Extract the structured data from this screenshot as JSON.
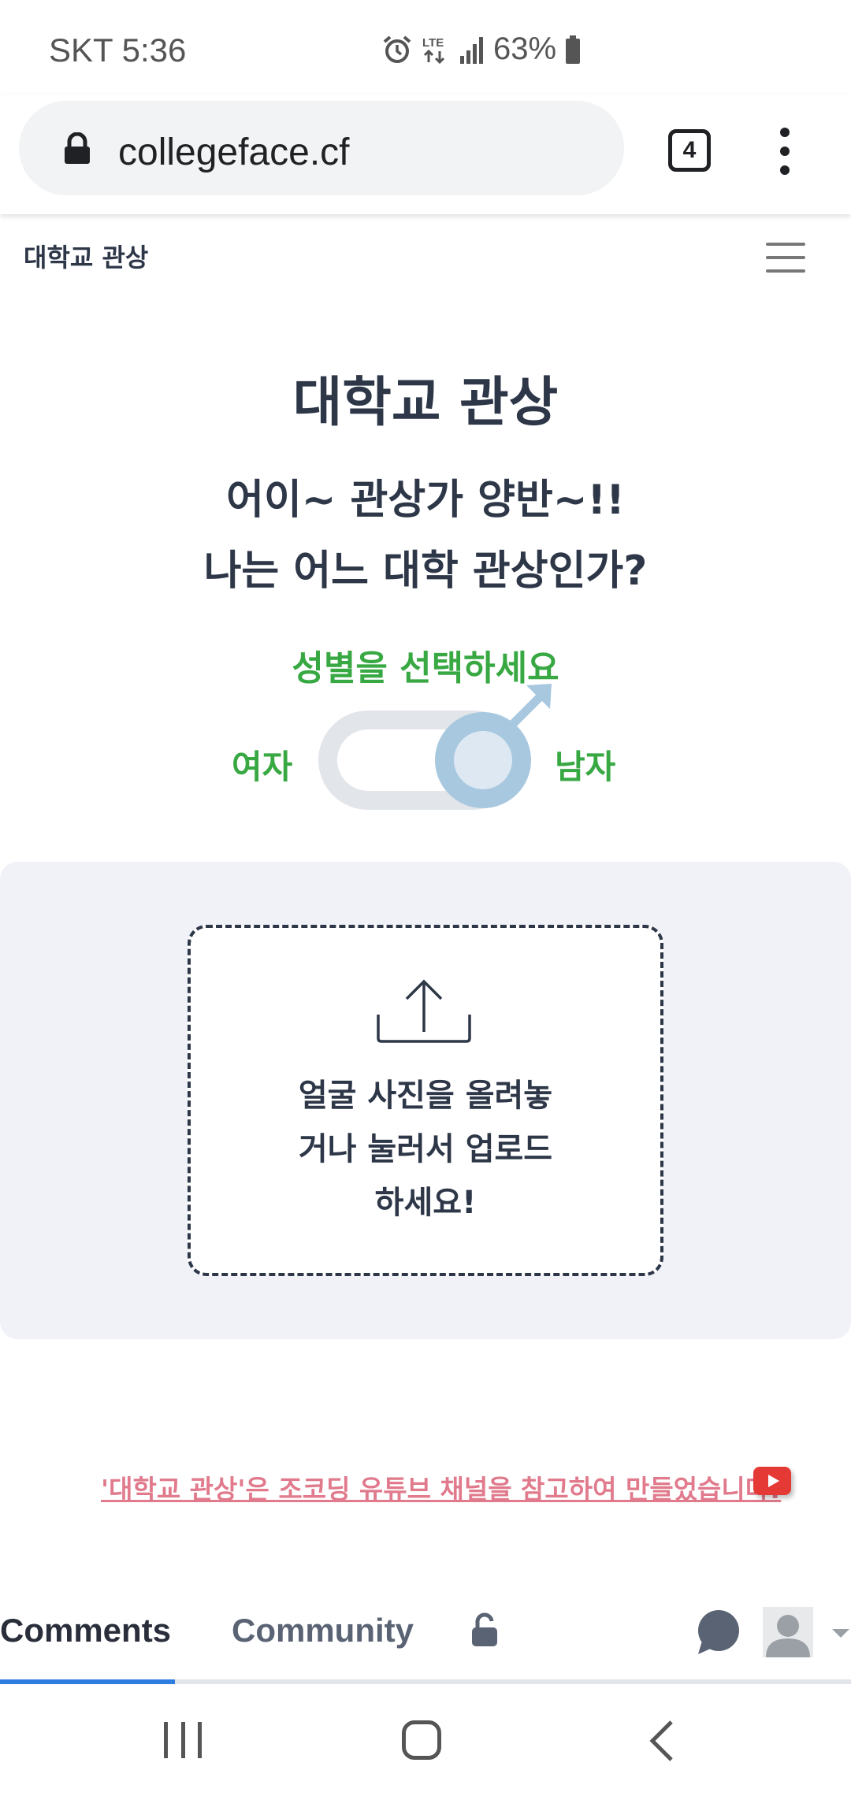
{
  "status_bar": {
    "carrier_time": "SKT 5:36",
    "network": "LTE",
    "battery": "63%",
    "icons": [
      "alarm-icon",
      "lte-icon",
      "signal-icon",
      "battery-icon"
    ]
  },
  "browser": {
    "url": "collegeface.cf",
    "tab_count": "4",
    "icons": [
      "lock-icon",
      "tabs-icon",
      "kebab-menu-icon"
    ]
  },
  "nav": {
    "brand": "대학교 관상",
    "menu_icon": "hamburger-icon"
  },
  "hero": {
    "title": "대학교 관상",
    "line1": "어이~ 관상가 양반~!!",
    "line2": "나는 어느 대학 관상인가?"
  },
  "gender": {
    "prompt": "성별을 선택하세요",
    "female": "여자",
    "male": "남자",
    "selected": "male",
    "icon": "male-symbol-icon"
  },
  "upload": {
    "line1": "얼굴 사진을 올려놓",
    "line2": "거나 눌러서 업로드",
    "line3": "하세요!",
    "icon": "upload-icon"
  },
  "credit": {
    "text": "'대학교 관상'은 조코딩 유튜브 채널을 참고하여 만들었습니다!",
    "icon": "youtube-icon"
  },
  "comments": {
    "tab_comments": "Comments",
    "tab_community": "Community",
    "active_tab": "Comments",
    "icons": [
      "padlock-icon",
      "chat-bubble-icon",
      "avatar",
      "caret-down-icon"
    ]
  },
  "android_nav": {
    "icons": [
      "recent-apps-icon",
      "home-icon",
      "back-icon"
    ]
  },
  "colors": {
    "text_dark": "#2d3748",
    "green": "#38a843",
    "toggle_blue": "#a8c8e0",
    "panel_bg": "#f0f2f8",
    "credit_pink": "#e07a8c",
    "youtube_red": "#e53935",
    "tab_underline": "#2e7de0"
  }
}
